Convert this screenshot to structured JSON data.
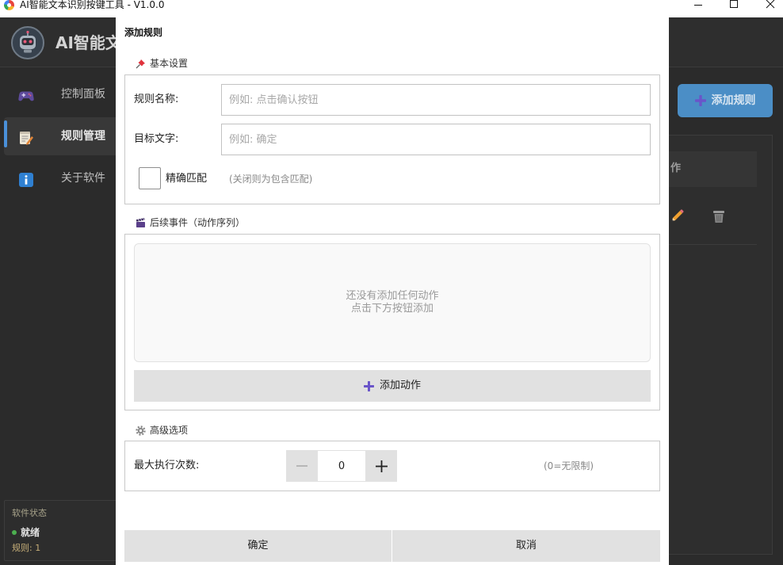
{
  "window": {
    "title": "AI智能文本识别按键工具 - V1.0.0",
    "icons": {
      "app": "app-icon",
      "minimize": "minimize-icon",
      "maximize": "maximize-icon",
      "close": "close-icon"
    }
  },
  "app": {
    "logo_icon": "robot-logo-icon",
    "title": "AI智能文"
  },
  "sidebar": {
    "items": [
      {
        "label": "控制面板",
        "icon": "gamepad-icon",
        "selected": false
      },
      {
        "label": "规则管理",
        "icon": "memo-icon",
        "selected": true
      },
      {
        "label": "关于软件",
        "icon": "info-icon",
        "selected": false
      }
    ],
    "status": {
      "heading": "软件状态",
      "state_icon": "status-dot-icon",
      "state": "就绪",
      "rules": "规则: 1"
    }
  },
  "main": {
    "add_rule_button": {
      "icon": "plus-icon",
      "label": "添加规则"
    },
    "rules_table": {
      "header_fragment": "作",
      "row_icons": [
        "pencil-icon",
        "trash-icon"
      ]
    }
  },
  "dialog": {
    "title": "添加规则",
    "basic": {
      "icon": "pushpin-icon",
      "heading": "基本设置",
      "name_label": "规则名称:",
      "name_value": "",
      "name_placeholder": "例如: 点击确认按钮",
      "target_label": "目标文字:",
      "target_value": "",
      "target_placeholder": "例如: 确定",
      "exact_checked": false,
      "exact_label": "精确匹配",
      "exact_hint": "(关闭则为包含匹配)"
    },
    "actions": {
      "icon": "clapper-board-icon",
      "heading": "后续事件（动作序列）",
      "empty_line1": "还没有添加任何动作",
      "empty_line2": "点击下方按钮添加",
      "add_button_icon": "plus-icon",
      "add_button_label": "添加动作"
    },
    "advanced": {
      "icon": "gear-icon",
      "heading": "高级选项",
      "max_runs_label": "最大执行次数:",
      "max_runs_value": "0",
      "max_runs_hint": "(0=无限制)"
    },
    "footer": {
      "ok": "确定",
      "cancel": "取消"
    }
  },
  "colors": {
    "accent_blue": "#4b8ec6",
    "selected_indicator": "#4a90d9",
    "status_ok": "#4caf50",
    "plus_purple": "#6a55c9",
    "app_bg": "#2b2b2b",
    "dialog_bg": "#ffffff"
  }
}
